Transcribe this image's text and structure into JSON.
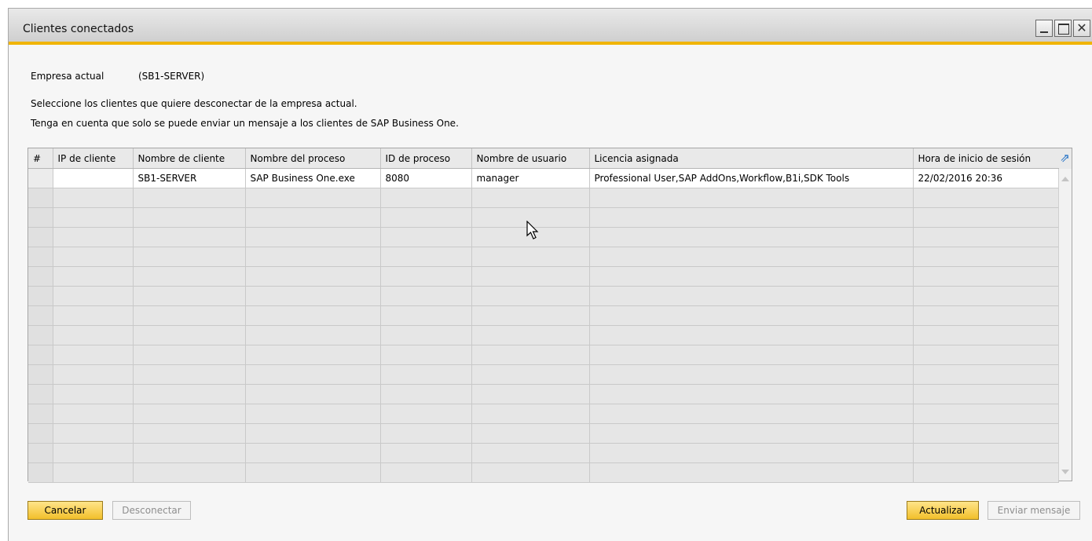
{
  "window": {
    "title": "Clientes conectados"
  },
  "company": {
    "label": "Empresa actual",
    "value": "(SB1-SERVER)"
  },
  "instructions": [
    "Seleccione los clientes que quiere desconectar de la empresa actual.",
    "Tenga en cuenta que solo se puede enviar un mensaje a los clientes de SAP Business One."
  ],
  "table": {
    "columns": [
      "#",
      "IP de cliente",
      "Nombre de cliente",
      "Nombre del proceso",
      "ID de proceso",
      "Nombre de usuario",
      "Licencia asignada",
      "Hora de inicio de sesión"
    ],
    "rows": [
      [
        "",
        "",
        "SB1-SERVER",
        "SAP Business One.exe",
        "8080",
        "manager",
        "Professional User,SAP AddOns,Workflow,B1i,SDK Tools",
        "22/02/2016 20:36"
      ]
    ],
    "empty_rows": 15
  },
  "buttons": {
    "cancel": "Cancelar",
    "disconnect": "Desconectar",
    "refresh": "Actualizar",
    "send_message": "Enviar mensaje"
  },
  "icons": {
    "minimize": "minimize-icon",
    "maximize": "maximize-icon",
    "close": "close-icon",
    "expand": "expand-arrow-icon",
    "cursor": "mouse-pointer-icon"
  },
  "colors": {
    "accent": "#f0b400",
    "primary_button": "#f2c02b",
    "expand_icon": "#1f6fc5"
  }
}
